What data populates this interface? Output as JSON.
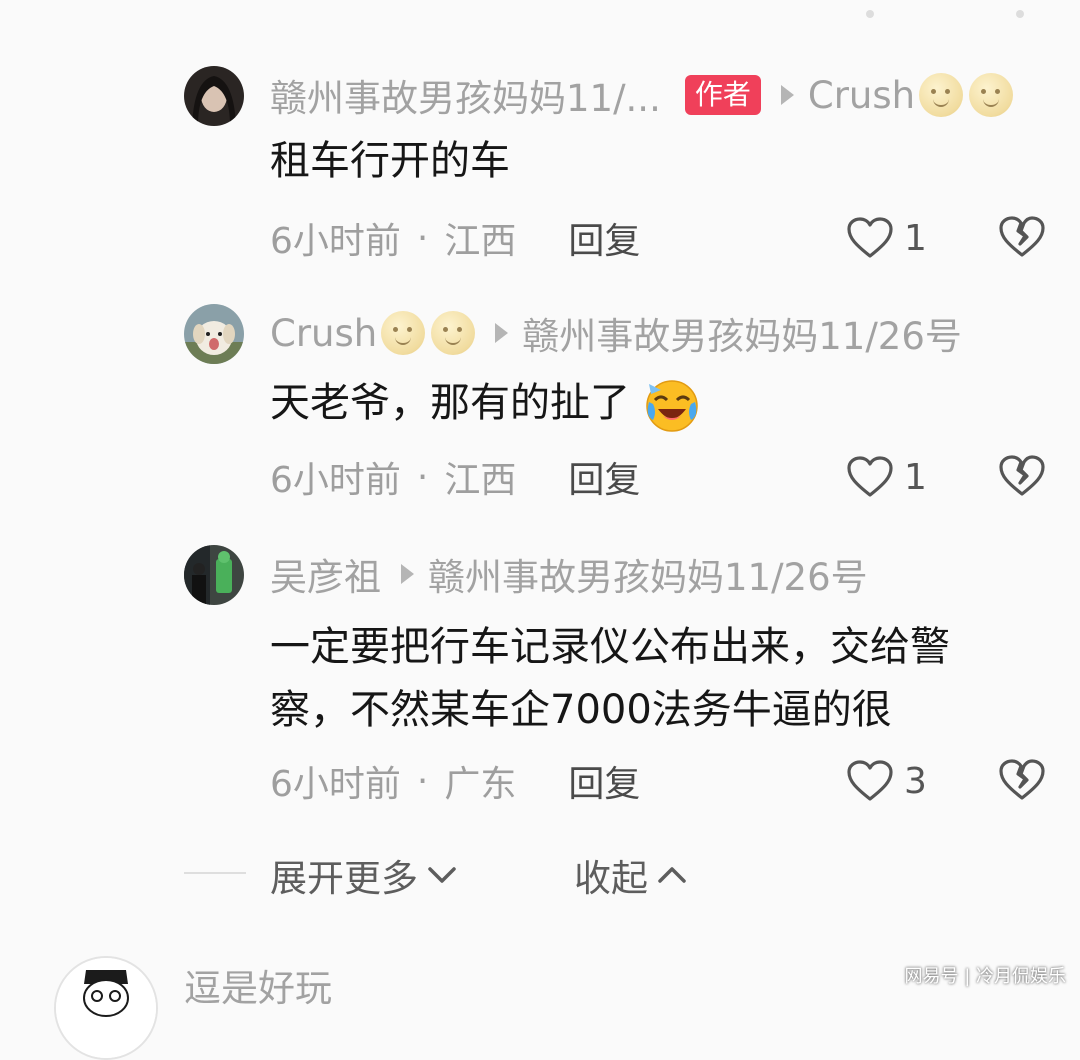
{
  "comments": [
    {
      "author": "赣州事故男孩妈妈11/...",
      "badge": "作者",
      "reply_to": "Crush",
      "text": "租车行开的车",
      "time": "6小时前",
      "location": "江西",
      "reply_label": "回复",
      "likes": "1"
    },
    {
      "author": "Crush",
      "reply_to": "赣州事故男孩妈妈11/26号",
      "text": "天老爷，那有的扯了",
      "time": "6小时前",
      "location": "江西",
      "reply_label": "回复",
      "likes": "1"
    },
    {
      "author": "吴彦祖",
      "reply_to": "赣州事故男孩妈妈11/26号",
      "text_line1": "一定要把行车记录仪公布出来，交给警",
      "text_line2": "察，不然某车企7000法务牛逼的很",
      "time": "6小时前",
      "location": "广东",
      "reply_label": "回复",
      "likes": "3"
    }
  ],
  "thread_controls": {
    "expand_label": "展开更多",
    "collapse_label": "收起"
  },
  "next_comment": {
    "author": "逗是好玩"
  },
  "watermark": "网易号 | 冷月侃娱乐",
  "icons": {
    "like": "heart-outline-icon",
    "dislike": "broken-heart-icon",
    "reply_arrow": "triangle-right-icon",
    "expand": "chevron-down-icon",
    "collapse": "chevron-up-icon"
  },
  "colors": {
    "author_badge": "#f0405a",
    "meta_text": "#9e9e9e",
    "name_text": "#a2a2a2"
  }
}
